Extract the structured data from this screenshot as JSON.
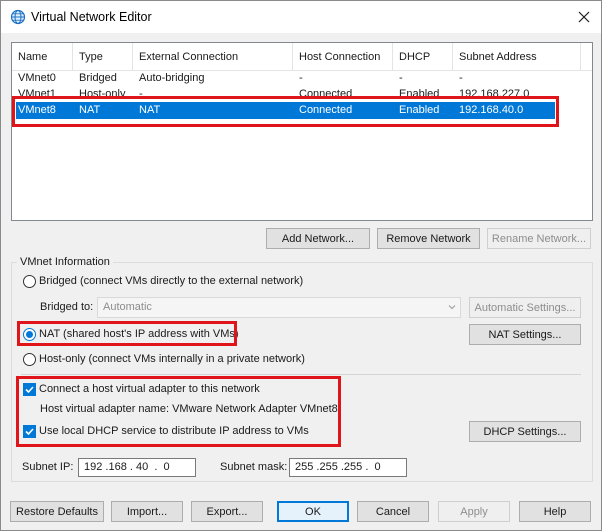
{
  "window": {
    "title": "Virtual Network Editor",
    "icon": "network-globe-icon",
    "close_icon": "close-icon"
  },
  "list": {
    "columns": [
      "Name",
      "Type",
      "External Connection",
      "Host Connection",
      "DHCP",
      "Subnet Address"
    ],
    "rows": [
      {
        "name": "VMnet0",
        "type": "Bridged",
        "external": "Auto-bridging",
        "host": "-",
        "dhcp": "-",
        "subnet": "-"
      },
      {
        "name": "VMnet1",
        "type": "Host-only",
        "external": "-",
        "host": "Connected",
        "dhcp": "Enabled",
        "subnet": "192.168.227.0"
      },
      {
        "name": "VMnet8",
        "type": "NAT",
        "external": "NAT",
        "host": "Connected",
        "dhcp": "Enabled",
        "subnet": "192.168.40.0"
      }
    ],
    "selected_row": "VMnet8"
  },
  "list_buttons": {
    "add": "Add Network...",
    "remove": "Remove Network",
    "rename": "Rename Network..."
  },
  "vmnet_info": {
    "group_label": "VMnet Information",
    "bridged_label": "Bridged (connect VMs directly to the external network)",
    "bridged_to_label": "Bridged to:",
    "bridged_to_value": "Automatic",
    "auto_settings": "Automatic Settings...",
    "nat_label": "NAT (shared host's IP address with VMs)",
    "nat_settings": "NAT Settings...",
    "hostonly_label": "Host-only (connect VMs internally in a private network)",
    "connect_adapter_label": "Connect a host virtual adapter to this network",
    "adapter_name_label": "Host virtual adapter name: VMware Network Adapter VMnet8",
    "dhcp_label": "Use local DHCP service to distribute IP address to VMs",
    "dhcp_settings": "DHCP Settings...",
    "subnet_ip_label": "Subnet IP:",
    "subnet_ip_value": "192 .168 . 40  .  0",
    "subnet_mask_label": "Subnet mask:",
    "subnet_mask_value": "255 .255 .255 .  0",
    "selected_mode": "NAT",
    "connect_adapter_checked": true,
    "dhcp_checked": true
  },
  "footer": {
    "restore": "Restore Defaults",
    "import": "Import...",
    "export": "Export...",
    "ok": "OK",
    "cancel": "Cancel",
    "apply": "Apply",
    "help": "Help"
  },
  "colors": {
    "selection": "#0078d7",
    "highlight": "#e0151c",
    "accent": "#0078d7"
  }
}
